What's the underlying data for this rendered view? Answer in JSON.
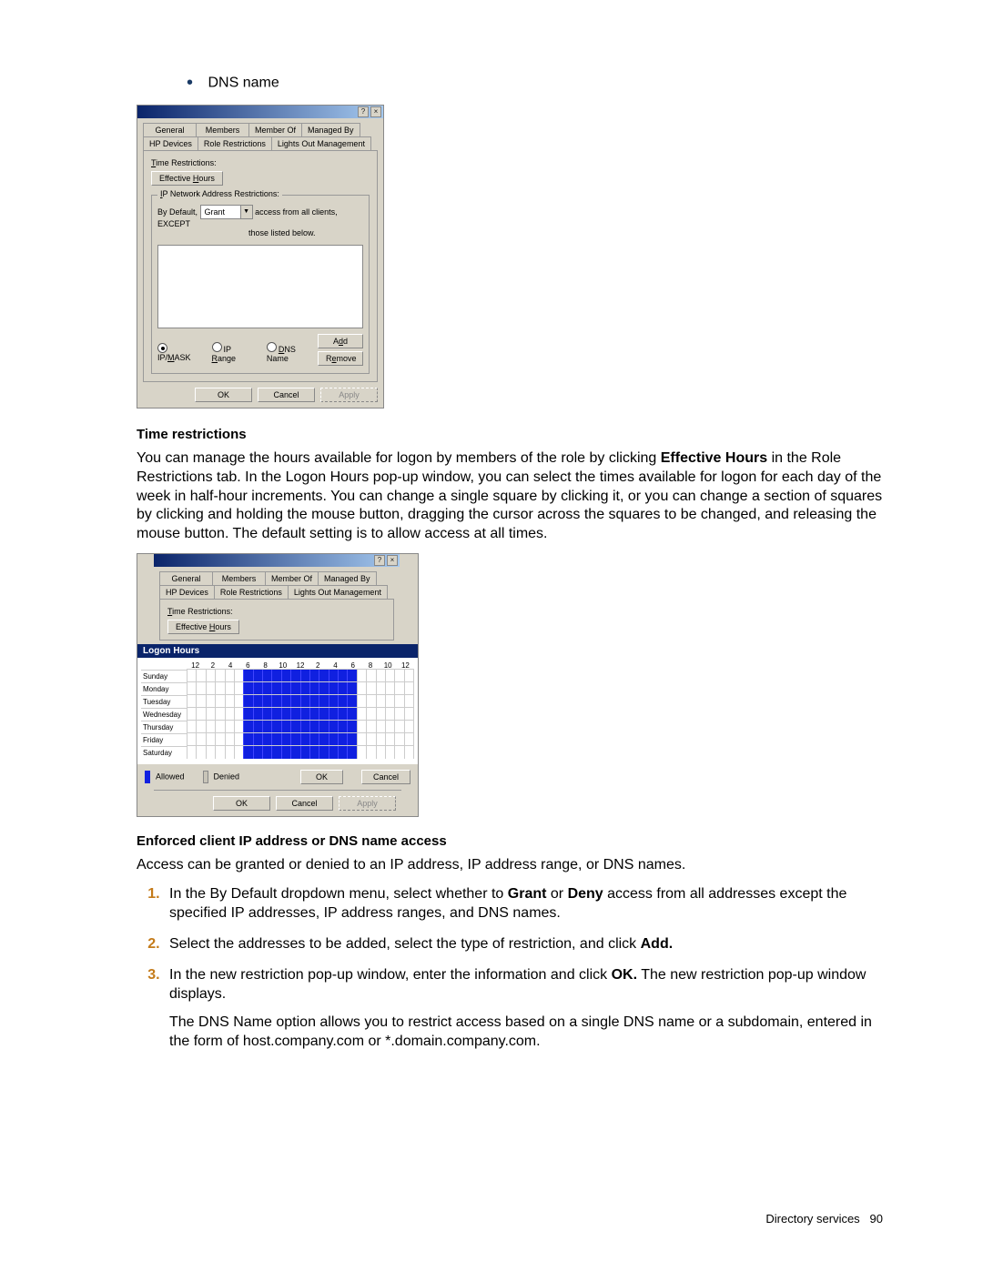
{
  "page": {
    "footer_label": "Directory services",
    "footer_pagenum": "90",
    "bullet_item": "DNS name"
  },
  "dialog1": {
    "tabs_row1": [
      "General",
      "Members",
      "Member Of",
      "Managed By"
    ],
    "tabs_row2": [
      "HP Devices",
      "Role Restrictions",
      "Lights Out Management"
    ],
    "time_restrictions_label": "Time Restrictions:",
    "effective_hours_btn": "Effective Hours",
    "ip_group_title": "IP Network Address Restrictions:",
    "by_default_label": "By Default,",
    "grant_value": "Grant",
    "access_text1": "access from all clients, EXCEPT",
    "access_text2": "those listed below.",
    "radio_ipmask": "IP/MASK",
    "radio_iprange": "IP Range",
    "radio_dnsname": "DNS Name",
    "add_btn": "Add",
    "remove_btn": "Remove",
    "ok_btn": "OK",
    "cancel_btn": "Cancel",
    "apply_btn": "Apply"
  },
  "dialog2": {
    "logon_hours_title": "Logon Hours",
    "hour_labels": [
      "12",
      "2",
      "4",
      "6",
      "8",
      "10",
      "12",
      "2",
      "4",
      "6",
      "8",
      "10",
      "12"
    ],
    "days": [
      {
        "name": "Sunday",
        "allowed": [
          0,
          0,
          0,
          0,
          0,
          0,
          1,
          1,
          1,
          1,
          1,
          1,
          1,
          1,
          1,
          1,
          1,
          1,
          0,
          0,
          0,
          0,
          0,
          0
        ]
      },
      {
        "name": "Monday",
        "allowed": [
          0,
          0,
          0,
          0,
          0,
          0,
          1,
          1,
          1,
          1,
          1,
          1,
          1,
          1,
          1,
          1,
          1,
          1,
          0,
          0,
          0,
          0,
          0,
          0
        ]
      },
      {
        "name": "Tuesday",
        "allowed": [
          0,
          0,
          0,
          0,
          0,
          0,
          1,
          1,
          1,
          1,
          1,
          1,
          1,
          1,
          1,
          1,
          1,
          1,
          0,
          0,
          0,
          0,
          0,
          0
        ]
      },
      {
        "name": "Wednesday",
        "allowed": [
          0,
          0,
          0,
          0,
          0,
          0,
          1,
          1,
          1,
          1,
          1,
          1,
          1,
          1,
          1,
          1,
          1,
          1,
          0,
          0,
          0,
          0,
          0,
          0
        ]
      },
      {
        "name": "Thursday",
        "allowed": [
          0,
          0,
          0,
          0,
          0,
          0,
          1,
          1,
          1,
          1,
          1,
          1,
          1,
          1,
          1,
          1,
          1,
          1,
          0,
          0,
          0,
          0,
          0,
          0
        ]
      },
      {
        "name": "Friday",
        "allowed": [
          0,
          0,
          0,
          0,
          0,
          0,
          1,
          1,
          1,
          1,
          1,
          1,
          1,
          1,
          1,
          1,
          1,
          1,
          0,
          0,
          0,
          0,
          0,
          0
        ]
      },
      {
        "name": "Saturday",
        "allowed": [
          0,
          0,
          0,
          0,
          0,
          0,
          1,
          1,
          1,
          1,
          1,
          1,
          1,
          1,
          1,
          1,
          1,
          1,
          0,
          0,
          0,
          0,
          0,
          0
        ]
      }
    ],
    "allowed_label": "Allowed",
    "denied_label": "Denied",
    "ok_btn": "OK",
    "cancel_btn": "Cancel",
    "tabs_row1": [
      "General",
      "Members",
      "Member Of",
      "Managed By"
    ],
    "tabs_row2": [
      "HP Devices",
      "Role Restrictions",
      "Lights Out Management"
    ],
    "time_restrictions_label": "Time Restrictions:",
    "effective_hours_btn": "Effective Hours",
    "footer_ok": "OK",
    "footer_cancel": "Cancel",
    "footer_apply": "Apply"
  },
  "section_time": {
    "heading": "Time restrictions",
    "body_pre": "You can manage the hours available for logon by members of the role by clicking ",
    "bold1": "Effective Hours",
    "body_post": " in the Role Restrictions tab. In the Logon Hours pop-up window, you can select the times available for logon for each day of the week in half-hour increments. You can change a single square by clicking it, or you can change a section of squares by clicking and holding the mouse button, dragging the cursor across the squares to be changed, and releasing the mouse button. The default setting is to allow access at all times."
  },
  "section_ip": {
    "heading": "Enforced client IP address or DNS name access",
    "intro": "Access can be granted or denied to an IP address, IP address range, or DNS names.",
    "step1_pre": "In the By Default dropdown menu, select whether to ",
    "step1_b1": "Grant",
    "step1_mid": " or ",
    "step1_b2": "Deny",
    "step1_post": " access from all addresses except the specified IP addresses, IP address ranges, and DNS names.",
    "step2_pre": "Select the addresses to be added, select the type of restriction, and click ",
    "step2_b1": "Add.",
    "step3_pre": "In the new restriction pop-up window, enter the information and click ",
    "step3_b1": "OK.",
    "step3_post": " The new restriction pop-up window displays.",
    "step3_para2": "The DNS Name option allows you to restrict access based on a single DNS name or a subdomain, entered in the form of host.company.com or *.domain.company.com."
  }
}
